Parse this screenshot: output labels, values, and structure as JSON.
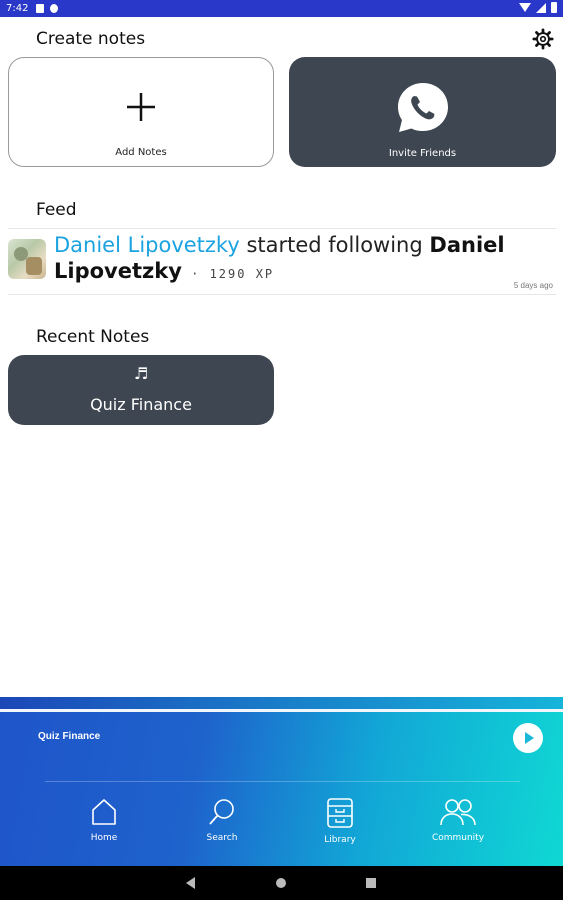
{
  "status_bar": {
    "time": "7:42"
  },
  "create_notes": {
    "title": "Create notes",
    "add_label": "Add Notes",
    "invite_label": "Invite Friends"
  },
  "feed": {
    "title": "Feed",
    "items": [
      {
        "actor": "Daniel Lipovetzky",
        "action": " started following ",
        "target": "Daniel Lipovetzky",
        "xp": " · 1290 XP",
        "time": "5 days ago"
      }
    ]
  },
  "recent_notes": {
    "title": "Recent Notes",
    "items": [
      {
        "title": "Quiz Finance",
        "icon": "music-note-icon"
      }
    ]
  },
  "player": {
    "now_playing": "Quiz Finance"
  },
  "bottom_nav": {
    "items": [
      {
        "label": "Home",
        "icon": "home-icon"
      },
      {
        "label": "Search",
        "icon": "search-icon"
      },
      {
        "label": "Library",
        "icon": "library-icon"
      },
      {
        "label": "Community",
        "icon": "community-icon"
      }
    ]
  },
  "colors": {
    "accent": "#1aa3e0",
    "card_dark": "#3e4651",
    "status_bar": "#2a38c9",
    "player_gradient_start": "#1f55c9",
    "player_gradient_end": "#0fd8d4"
  }
}
